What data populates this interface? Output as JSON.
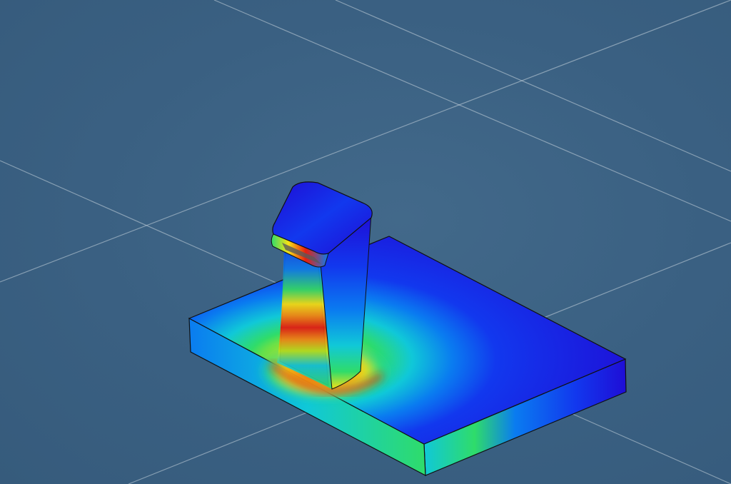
{
  "viewport": {
    "background_color": "#3b6283",
    "grid_line_color": "#c7d3dd"
  },
  "model": {
    "type": "fea-stress-contour",
    "shape": "base-plate-with-hook",
    "colormap": [
      "#1f0dd6",
      "#1238ee",
      "#0a7cf0",
      "#10c8d8",
      "#2fdc6a",
      "#b8e61a",
      "#f7e114",
      "#f48a12",
      "#e61e10",
      "#5a5a5a"
    ],
    "edge_color": "#111111"
  }
}
